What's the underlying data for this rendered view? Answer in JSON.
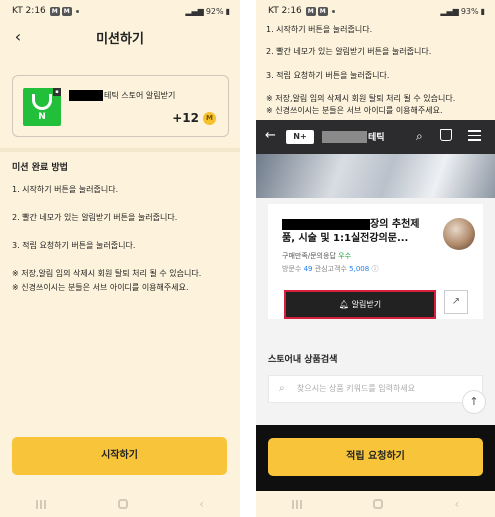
{
  "left": {
    "status": {
      "time": "KT 2:16",
      "badges": [
        "M",
        "M"
      ],
      "battery": "92%"
    },
    "title": "미션하기",
    "mission": {
      "name_suffix": "테틱 스토어 알림받기",
      "logo_letter": "N",
      "reward": "+12",
      "coin_label": "M"
    },
    "section_title": "미션 완료 방법",
    "steps": [
      "1. 시작하기 버튼을 눌러줍니다.",
      "2. 빨간 네모가 있는 알림받기 버튼을 눌러줍니다.",
      "3. 적립 요청하기 버튼을 눌러줍니다."
    ],
    "notes": [
      "※ 저장,알림 임의 삭제시 회원 탈퇴 처리 될 수 있습니다.",
      "※ 신경쓰이시는 분들은 서브 아이디를 이용해주세요."
    ],
    "start_label": "시작하기"
  },
  "right": {
    "status": {
      "time": "KT 2:16",
      "badges": [
        "M",
        "M"
      ],
      "battery": "93%"
    },
    "steps": [
      "1. 시작하기 버튼을 눌러줍니다.",
      "2. 빨간 네모가 있는 알림받기 버튼을 눌러줍니다.",
      "3. 적립 요청하기 버튼을 눌러줍니다."
    ],
    "notes": [
      "※ 저장,알림 임의 삭제시 회원 탈퇴 처리 될 수 있습니다.",
      "※ 신경쓰이시는 분들은 서브 아이디를 이용해주세요."
    ],
    "web": {
      "logo": "N+",
      "store_suffix": "테틱",
      "store_title_line1": "장의 추천제",
      "store_title_line2": "품, 시술 및 1:1실전강의문...",
      "meta_prefix": "구매만족/문의응답",
      "meta_rating": "우수",
      "visitors_label": "방문수",
      "visitors": "49",
      "fans_label": "관심고객수",
      "fans": "5,008",
      "notify_label": "알림받기",
      "search_title": "스토어내 상품검색",
      "search_placeholder": "찾으시는 상품 키워드를 입력하세요"
    },
    "request_label": "적립 요청하기"
  }
}
